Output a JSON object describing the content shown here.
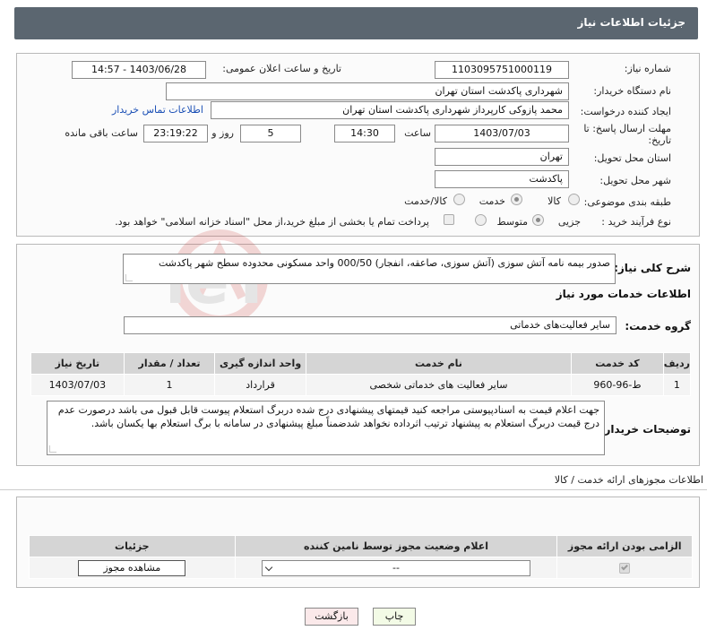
{
  "header": {
    "title": "جزئیات اطلاعات نیاز"
  },
  "need_info": {
    "need_number_label": "شماره نیاز:",
    "need_number": "1103095751000119",
    "announce_label": "تاریخ و ساعت اعلان عمومی:",
    "announce_value": "1403/06/28 - 14:57",
    "buyer_org_label": "نام دستگاه خریدار:",
    "buyer_org": "شهرداری پاکدشت استان تهران",
    "requester_label": "ایجاد کننده درخواست:",
    "requester": "محمد پازوکی کارپرداز شهرداری پاکدشت استان تهران",
    "contact_link": "اطلاعات تماس خریدار",
    "deadline_label_1": "مهلت ارسال پاسخ: تا",
    "deadline_label_2": "تاریخ:",
    "deadline_date": "1403/07/03",
    "time_label": "ساعت",
    "deadline_time": "14:30",
    "days_value": "5",
    "days_label": "روز و",
    "remaining_time": "23:19:22",
    "remaining_label": "ساعت باقی مانده",
    "province_label": "استان محل تحویل:",
    "province": "تهران",
    "city_label": "شهر محل تحویل:",
    "city": "پاکدشت",
    "category_label": "طبقه بندی موضوعی:",
    "category_options": [
      "کالا",
      "خدمت",
      "کالا/خدمت"
    ],
    "category_selected": "خدمت",
    "process_label": "نوع فرآیند خرید :",
    "process_options": [
      "جزیی",
      "متوسط"
    ],
    "process_selected": "جزیی",
    "treasury_note": "پرداخت تمام یا بخشی از مبلغ خرید،از محل \"اسناد خزانه اسلامی\" خواهد بود."
  },
  "summary": {
    "label": "شرح کلی نیاز:",
    "text": "صدور بیمه نامه آتش سوزی (آتش سوزی، صاعقه، انفجار) 000/50 واحد مسکونی محدوده سطح شهر پاکدشت",
    "services_title": "اطلاعات خدمات مورد نیاز",
    "group_label": "گروه خدمت:",
    "group_value": "سایر فعالیت‌های خدماتی"
  },
  "services_table": {
    "headers": [
      "ردیف",
      "کد خدمت",
      "نام خدمت",
      "واحد اندازه گیری",
      "تعداد / مقدار",
      "تاریخ نیاز"
    ],
    "rows": [
      [
        "1",
        "ط-96-960",
        "سایر فعالیت های خدماتی شخصی",
        "قرارداد",
        "1",
        "1403/07/03"
      ]
    ]
  },
  "buyer_notes": {
    "label": "توضیحات خریدار:",
    "text": "جهت اعلام قیمت به اسنادپیوستی مراجعه کنید قیمتهای پیشنهادی درج شده دربرگ استعلام پیوست قابل قبول می باشد درصورت عدم درج قیمت دربرگ استعلام به پیشنهاد ترتیب اثرداده نخواهد شدضمناً مبلغ پیشنهادی در سامانه با برگ استعلام بها یکسان باشد."
  },
  "permits": {
    "section_title": "اطلاعات مجوزهای ارائه خدمت / کالا",
    "headers": [
      "الزامی بودن ارائه مجوز",
      "اعلام وضعیت مجوز توسط نامین کننده",
      "جزئیات"
    ],
    "select_value": "--",
    "view_button": "مشاهده مجوز"
  },
  "footer": {
    "print_button": "چاپ",
    "back_button": "بازگشت"
  },
  "watermark": {
    "text": "AriaTender.neT"
  },
  "colors": {
    "header_bg": "#5b6670",
    "link": "#1a4fb5",
    "print_bg": "#f3fbe6",
    "back_bg": "#fbe9ea"
  }
}
